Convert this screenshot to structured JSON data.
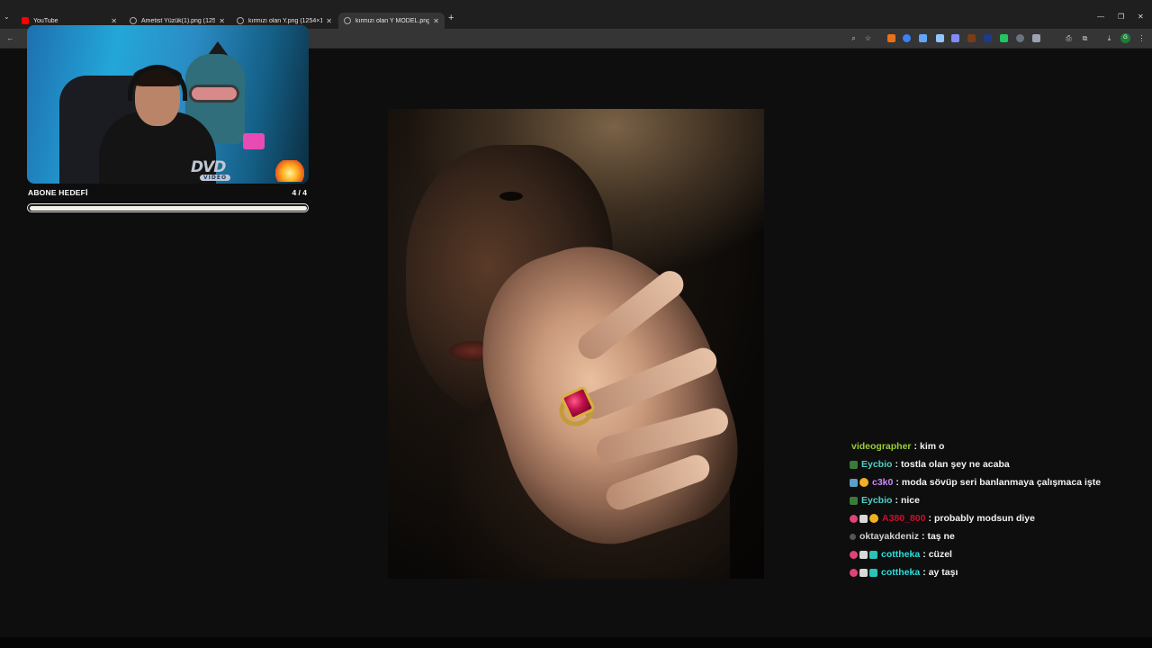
{
  "browser": {
    "tabs": [
      {
        "title": "YouTube",
        "favicon": "youtube-icon",
        "active": false
      },
      {
        "title": "Ametist Yüzük(1).png (1254×12...",
        "favicon": "globe-icon",
        "active": false
      },
      {
        "title": "kırmızı olan Y.png (1254×1254)",
        "favicon": "globe-icon",
        "active": false
      },
      {
        "title": "kırmızı olan Y MODEL.png (113...",
        "favicon": "globe-icon",
        "active": true
      }
    ],
    "new_tab_label": "+",
    "profile_initial": "G"
  },
  "overlay": {
    "sub_goal_label": "ABONE HEDEFİ",
    "sub_goal_count": "4 / 4",
    "sub_goal_progress": 1.0,
    "dvd_text": "DVD",
    "dvd_sub": "VIDEO"
  },
  "chat": {
    "messages": [
      {
        "user": "videographer",
        "color": "#9acd32",
        "text": "kim o",
        "badges": []
      },
      {
        "user": "Eycbio",
        "color": "#4fd1c5",
        "text": "tostla olan şey ne acaba",
        "badges": [
          "green"
        ]
      },
      {
        "user": "c3k0",
        "color": "#c58af9",
        "text": "moda sövüp seri banlanmaya çalışmaca işte",
        "badges": [
          "sub",
          "gold"
        ]
      },
      {
        "user": "Eycbio",
        "color": "#4fd1c5",
        "text": "nice",
        "badges": [
          "green"
        ]
      },
      {
        "user": "A380_800",
        "color": "#c8102e",
        "text": "probably modsun diye",
        "badges": [
          "bits",
          "gift",
          "gold"
        ]
      },
      {
        "user": "oktayakdeniz",
        "color": "#d0d0d0",
        "text": "taş ne",
        "badges": [
          "grey"
        ]
      },
      {
        "user": "cottheka",
        "color": "#29e0e0",
        "text": "cüzel",
        "badges": [
          "bits",
          "gift",
          "teal"
        ]
      },
      {
        "user": "cottheka",
        "color": "#29e0e0",
        "text": "ay taşı",
        "badges": [
          "bits",
          "gift",
          "teal"
        ]
      }
    ]
  }
}
